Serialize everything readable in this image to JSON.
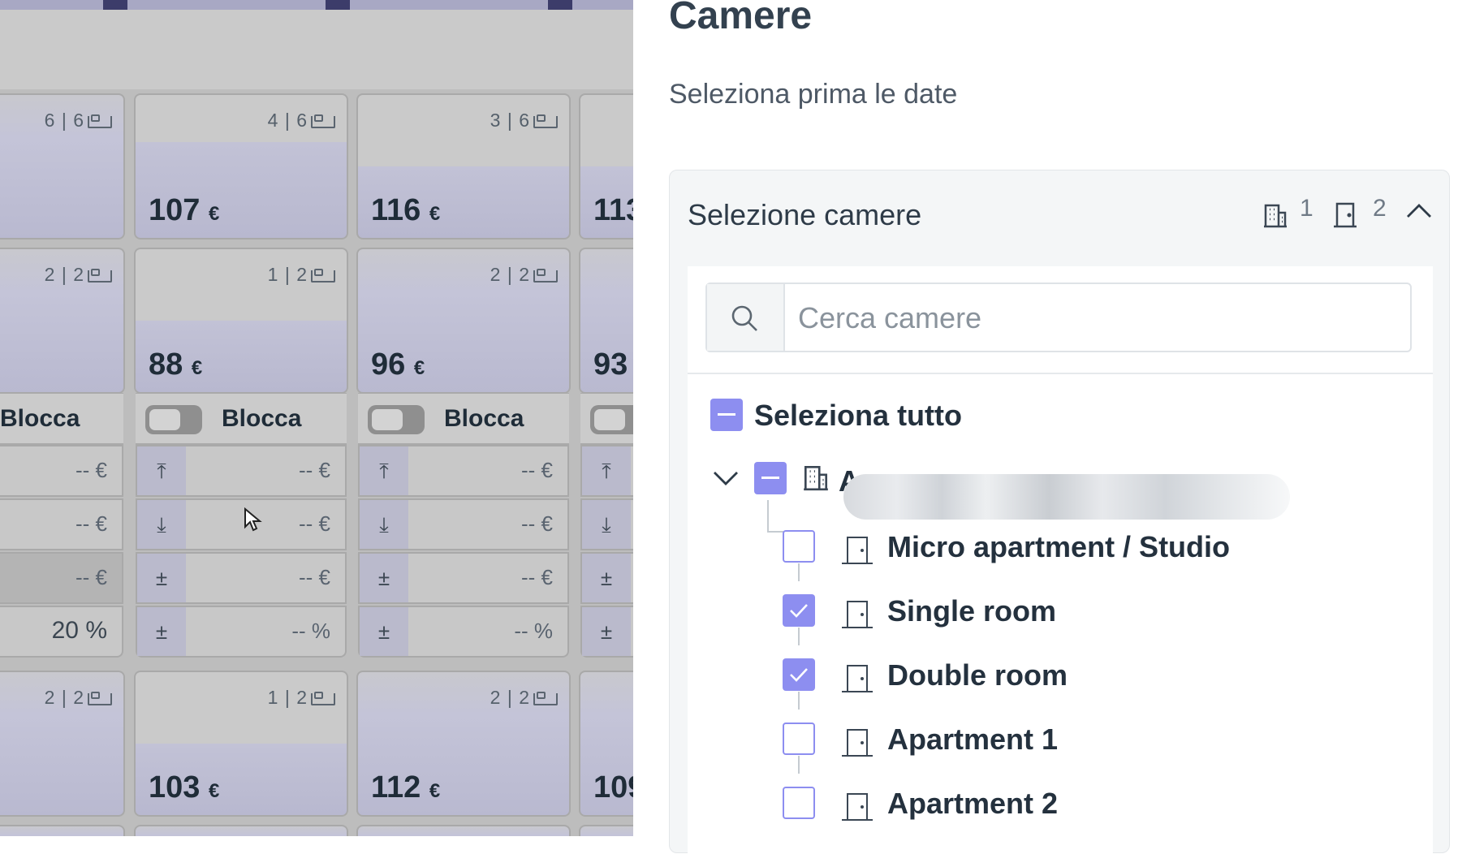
{
  "calendar": {
    "cells": [
      {
        "capacity": "6 | 6",
        "price": "",
        "col": 0,
        "row": 0
      },
      {
        "capacity": "4 | 6",
        "price": "107",
        "col": 1,
        "row": 0
      },
      {
        "capacity": "3 | 6",
        "price": "116",
        "col": 2,
        "row": 0
      },
      {
        "capacity": "",
        "price": "113",
        "col": 3,
        "row": 0
      },
      {
        "capacity": "2 | 2",
        "price": "",
        "col": 0,
        "row": 1
      },
      {
        "capacity": "1 | 2",
        "price": "88",
        "col": 1,
        "row": 1
      },
      {
        "capacity": "2 | 2",
        "price": "96",
        "col": 2,
        "row": 1
      },
      {
        "capacity": "",
        "price": "93",
        "col": 3,
        "row": 1
      },
      {
        "capacity": "2 | 2",
        "price": "",
        "col": 0,
        "row": 2
      },
      {
        "capacity": "1 | 2",
        "price": "103",
        "col": 1,
        "row": 2
      },
      {
        "capacity": "2 | 2",
        "price": "112",
        "col": 2,
        "row": 2
      },
      {
        "capacity": "",
        "price": "109",
        "col": 3,
        "row": 2
      }
    ],
    "currency": "€",
    "block_label": "Blocca",
    "empty_price": "-- €",
    "empty_percent": "-- %",
    "percent_value": "20 %"
  },
  "panel": {
    "title": "Camere",
    "subtitle": "Seleziona prima le date",
    "card_title": "Selezione camere",
    "property_count": "1",
    "room_count": "2",
    "search_placeholder": "Cerca camere",
    "select_all": "Seleziona tutto",
    "property_name_visible": "A",
    "rooms": [
      {
        "label": "Micro apartment / Studio",
        "checked": false
      },
      {
        "label": "Single room",
        "checked": true
      },
      {
        "label": "Double room",
        "checked": true
      },
      {
        "label": "Apartment 1",
        "checked": false
      },
      {
        "label": "Apartment 2",
        "checked": false
      }
    ]
  },
  "colors": {
    "accent": "#8d8ef0",
    "text": "#24313e"
  }
}
